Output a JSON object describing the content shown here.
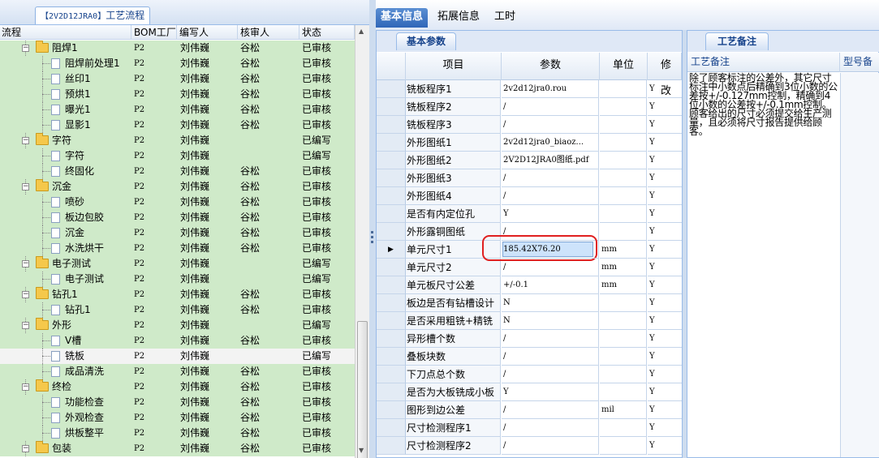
{
  "window": {
    "title_code": "【2V2D12JRA0】",
    "title_text": "工艺流程"
  },
  "tree": {
    "columns": [
      "流程",
      "BOM工厂",
      "编写人",
      "核审人",
      "状态"
    ],
    "rows": [
      {
        "name": "阻焊1",
        "type": "group",
        "bom": "P2",
        "writer": "刘伟巍",
        "reviewer": "谷松",
        "status": "已审核"
      },
      {
        "name": "阻焊前处理1",
        "type": "leaf",
        "bom": "P2",
        "writer": "刘伟巍",
        "reviewer": "谷松",
        "status": "已审核"
      },
      {
        "name": "丝印1",
        "type": "leaf",
        "bom": "P2",
        "writer": "刘伟巍",
        "reviewer": "谷松",
        "status": "已审核"
      },
      {
        "name": "预烘1",
        "type": "leaf",
        "bom": "P2",
        "writer": "刘伟巍",
        "reviewer": "谷松",
        "status": "已审核"
      },
      {
        "name": "曝光1",
        "type": "leaf",
        "bom": "P2",
        "writer": "刘伟巍",
        "reviewer": "谷松",
        "status": "已审核"
      },
      {
        "name": "显影1",
        "type": "leaf",
        "bom": "P2",
        "writer": "刘伟巍",
        "reviewer": "谷松",
        "status": "已审核"
      },
      {
        "name": "字符",
        "type": "group",
        "bom": "P2",
        "writer": "刘伟巍",
        "reviewer": "",
        "status": "已编写"
      },
      {
        "name": "字符",
        "type": "leaf",
        "bom": "P2",
        "writer": "刘伟巍",
        "reviewer": "",
        "status": "已编写"
      },
      {
        "name": "终固化",
        "type": "leaf",
        "bom": "P2",
        "writer": "刘伟巍",
        "reviewer": "谷松",
        "status": "已审核"
      },
      {
        "name": "沉金",
        "type": "group",
        "bom": "P2",
        "writer": "刘伟巍",
        "reviewer": "谷松",
        "status": "已审核"
      },
      {
        "name": "喷砂",
        "type": "leaf",
        "bom": "P2",
        "writer": "刘伟巍",
        "reviewer": "谷松",
        "status": "已审核"
      },
      {
        "name": "板边包胶",
        "type": "leaf",
        "bom": "P2",
        "writer": "刘伟巍",
        "reviewer": "谷松",
        "status": "已审核"
      },
      {
        "name": "沉金",
        "type": "leaf",
        "bom": "P2",
        "writer": "刘伟巍",
        "reviewer": "谷松",
        "status": "已审核"
      },
      {
        "name": "水洗烘干",
        "type": "leaf",
        "bom": "P2",
        "writer": "刘伟巍",
        "reviewer": "谷松",
        "status": "已审核"
      },
      {
        "name": "电子测试",
        "type": "group",
        "bom": "P2",
        "writer": "刘伟巍",
        "reviewer": "",
        "status": "已编写"
      },
      {
        "name": "电子测试",
        "type": "leaf",
        "bom": "P2",
        "writer": "刘伟巍",
        "reviewer": "",
        "status": "已编写"
      },
      {
        "name": "钻孔1",
        "type": "group",
        "bom": "P2",
        "writer": "刘伟巍",
        "reviewer": "谷松",
        "status": "已审核"
      },
      {
        "name": "钻孔1",
        "type": "leaf",
        "bom": "P2",
        "writer": "刘伟巍",
        "reviewer": "谷松",
        "status": "已审核"
      },
      {
        "name": "外形",
        "type": "group",
        "bom": "P2",
        "writer": "刘伟巍",
        "reviewer": "",
        "status": "已编写"
      },
      {
        "name": "V槽",
        "type": "leaf",
        "bom": "P2",
        "writer": "刘伟巍",
        "reviewer": "谷松",
        "status": "已审核"
      },
      {
        "name": "铣板",
        "type": "leaf",
        "bom": "P2",
        "writer": "刘伟巍",
        "reviewer": "",
        "status": "已编写",
        "selected": true
      },
      {
        "name": "成品清洗",
        "type": "leaf",
        "bom": "P2",
        "writer": "刘伟巍",
        "reviewer": "谷松",
        "status": "已审核"
      },
      {
        "name": "终检",
        "type": "group",
        "bom": "P2",
        "writer": "刘伟巍",
        "reviewer": "谷松",
        "status": "已审核"
      },
      {
        "name": "功能检查",
        "type": "leaf",
        "bom": "P2",
        "writer": "刘伟巍",
        "reviewer": "谷松",
        "status": "已审核"
      },
      {
        "name": "外观检查",
        "type": "leaf",
        "bom": "P2",
        "writer": "刘伟巍",
        "reviewer": "谷松",
        "status": "已审核"
      },
      {
        "name": "烘板整平",
        "type": "leaf",
        "bom": "P2",
        "writer": "刘伟巍",
        "reviewer": "谷松",
        "status": "已审核"
      },
      {
        "name": "包装",
        "type": "group",
        "bom": "P2",
        "writer": "刘伟巍",
        "reviewer": "谷松",
        "status": "已审核"
      }
    ]
  },
  "tabs": [
    "基本信息",
    "拓展信息",
    "工时"
  ],
  "params_panel": {
    "tab": "基本参数",
    "columns": [
      "项目",
      "参数",
      "单位",
      "修改"
    ],
    "rows": [
      {
        "item": "铣板程序1",
        "param": "2v2d12jra0.rou",
        "unit": "",
        "mod": "Y"
      },
      {
        "item": "铣板程序2",
        "param": "/",
        "unit": "",
        "mod": "Y"
      },
      {
        "item": "铣板程序3",
        "param": "/",
        "unit": "",
        "mod": "Y"
      },
      {
        "item": "外形图纸1",
        "param": "2v2d12jra0_biaoz...",
        "unit": "",
        "mod": "Y"
      },
      {
        "item": "外形图纸2",
        "param": "2V2D12JRA0图纸.pdf",
        "unit": "",
        "mod": "Y"
      },
      {
        "item": "外形图纸3",
        "param": "/",
        "unit": "",
        "mod": "Y"
      },
      {
        "item": "外形图纸4",
        "param": "/",
        "unit": "",
        "mod": "Y"
      },
      {
        "item": "是否有内定位孔",
        "param": "Y",
        "unit": "",
        "mod": "Y"
      },
      {
        "item": "外形露铜图纸",
        "param": "/",
        "unit": "",
        "mod": "Y"
      },
      {
        "item": "单元尺寸1",
        "param": "185.42X76.20",
        "unit": "mm",
        "mod": "Y",
        "editing": true
      },
      {
        "item": "单元尺寸2",
        "param": "/",
        "unit": "mm",
        "mod": "Y"
      },
      {
        "item": "单元板尺寸公差",
        "param": "+/-0.1",
        "unit": "mm",
        "mod": "Y"
      },
      {
        "item": "板边是否有钻槽设计",
        "param": "N",
        "unit": "",
        "mod": "Y"
      },
      {
        "item": "是否采用粗铣+精铣",
        "param": "N",
        "unit": "",
        "mod": "Y"
      },
      {
        "item": "异形槽个数",
        "param": "/",
        "unit": "",
        "mod": "Y"
      },
      {
        "item": "叠板块数",
        "param": "/",
        "unit": "",
        "mod": "Y"
      },
      {
        "item": "下刀点总个数",
        "param": "/",
        "unit": "",
        "mod": "Y"
      },
      {
        "item": "是否为大板铣成小板",
        "param": "Y",
        "unit": "",
        "mod": "Y"
      },
      {
        "item": "图形到边公差",
        "param": "/",
        "unit": "mil",
        "mod": "Y"
      },
      {
        "item": "尺寸检测程序1",
        "param": "/",
        "unit": "",
        "mod": "Y"
      },
      {
        "item": "尺寸检测程序2",
        "param": "/",
        "unit": "",
        "mod": "Y"
      }
    ]
  },
  "notes_panel": {
    "tab": "工艺备注",
    "col1": "工艺备注",
    "col2": "型号备",
    "text": "除了顾客标注的公差外，其它尺寸标注中小数点后精确到3位小数的公差按+/-0.127mm控制，精确到4位小数的公差按+/-0.1mm控制。顾客给出的尺寸必须提交给生产测量，且必须将尺寸报告提供给顾客。"
  },
  "colors": {
    "tree_row_bg": "#cfeac9",
    "accent_tab": "#2f66b8",
    "highlight_ring": "#e02020"
  }
}
